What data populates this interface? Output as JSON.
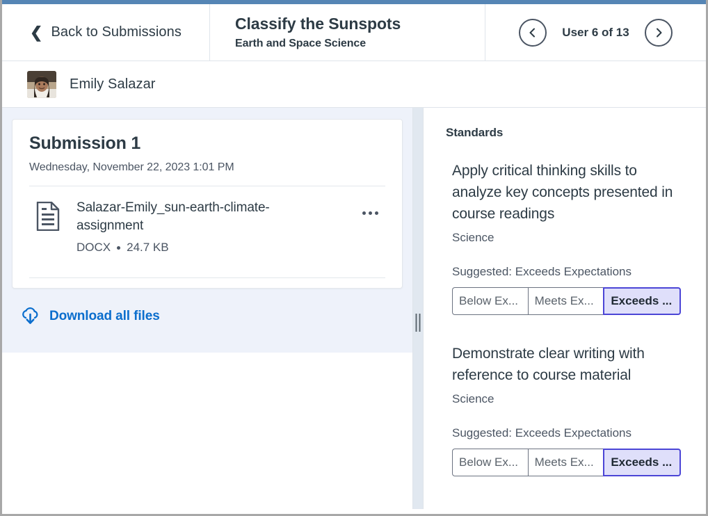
{
  "colors": {
    "accent_bar": "#5585b5",
    "link_blue": "#0b6ecd",
    "selected_bg": "#dfdffa",
    "selected_border": "#4b45d6",
    "pane_blue": "#eef2fa",
    "text_primary": "#2d3b45",
    "text_secondary": "#4b5563"
  },
  "header": {
    "back_label": "Back to Submissions",
    "back_icon": "chevron-left-icon",
    "assignment_title": "Classify the Sunspots",
    "course_name": "Earth and Space Science",
    "prev_icon": "chevron-left-circle-icon",
    "next_icon": "chevron-right-circle-icon",
    "user_count": "User 6 of 13"
  },
  "student": {
    "name": "Emily Salazar",
    "avatar_icon": "avatar"
  },
  "submission": {
    "title": "Submission 1",
    "timestamp": "Wednesday, November 22, 2023 1:01 PM",
    "file": {
      "icon": "document-icon",
      "name": "Salazar-Emily_sun-earth-climate-assignment",
      "type": "DOCX",
      "size": "24.7 KB",
      "menu_icon": "kebab-menu-icon"
    },
    "download_label": "Download all files",
    "download_icon": "cloud-download-icon"
  },
  "standards": {
    "heading": "Standards",
    "items": [
      {
        "description": "Apply critical thinking skills to analyze key concepts presented in course readings",
        "subject": "Science",
        "suggested": "Suggested: Exceeds Expectations",
        "ratings": [
          {
            "label": "Below Ex...",
            "selected": false
          },
          {
            "label": "Meets Ex...",
            "selected": false
          },
          {
            "label": "Exceeds ...",
            "selected": true
          }
        ]
      },
      {
        "description": "Demonstrate clear writing with reference to course material",
        "subject": "Science",
        "suggested": "Suggested: Exceeds Expectations",
        "ratings": [
          {
            "label": "Below Ex...",
            "selected": false
          },
          {
            "label": "Meets Ex...",
            "selected": false
          },
          {
            "label": "Exceeds ...",
            "selected": true
          }
        ]
      }
    ]
  },
  "resizer": {
    "name": "pane-resizer"
  }
}
